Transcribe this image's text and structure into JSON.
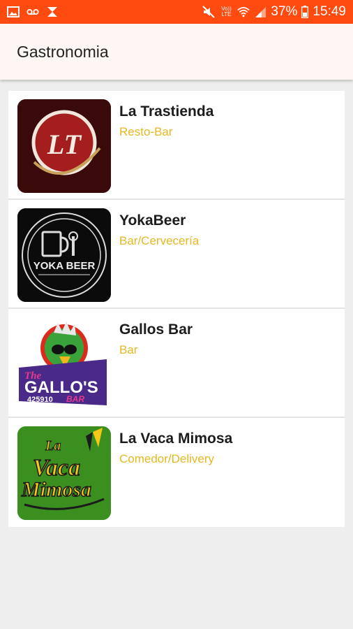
{
  "status_bar": {
    "battery": "37%",
    "time": "15:49",
    "lte_label": "Vo))\nLTE",
    "icons": [
      "image-icon",
      "voicemail-icon",
      "notification-icon",
      "mute-icon",
      "volte-icon",
      "wifi-icon",
      "signal-icon",
      "battery-icon"
    ]
  },
  "app_bar": {
    "title": "Gastronomia"
  },
  "colors": {
    "status_bar": "#ff4a10",
    "category": "#e6b821",
    "app_bar": "#fdf6f3"
  },
  "items": [
    {
      "name": "La Trastienda",
      "category": "Resto-Bar",
      "logo_text": "LT"
    },
    {
      "name": "YokaBeer",
      "category": "Bar/Cervecería",
      "logo_text": "YOKA BEER"
    },
    {
      "name": "Gallos Bar",
      "category": "Bar",
      "logo_text": [
        "The",
        "GALLO'S",
        "425910",
        "BAR"
      ]
    },
    {
      "name": "La Vaca Mimosa",
      "category": "Comedor/Delivery",
      "logo_text": [
        "La",
        "Vaca",
        "Mimosa"
      ]
    }
  ]
}
